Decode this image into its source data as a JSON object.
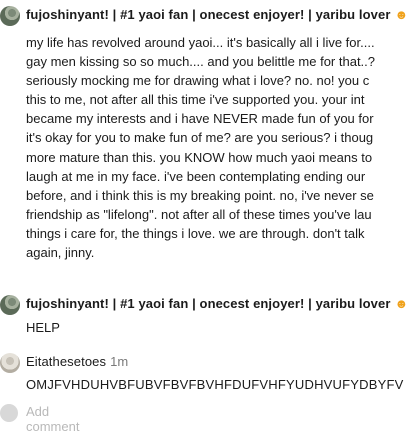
{
  "comments": [
    {
      "author": "fujoshinyant! | #1 yaoi fan | onecest enjoyer! | yaribu lover",
      "badge": "☻",
      "lines": [
        "my life has revolved around yaoi... it's basically all i live for....",
        "gay men kissing so so much.... and you belittle me for that..?",
        "seriously mocking me for drawing what i love? no. no! you c",
        "this to me, not after all this time i've supported you. your int",
        "became my interests and i have NEVER made fun of you for",
        "it's okay for you to make fun of me? are you serious? i thoug",
        "more mature than this. you KNOW how much yaoi means to",
        "laugh at me in my face. i've been contemplating ending our",
        "before, and i think this is my breaking point. no, i've never se",
        "friendship as \"lifelong\". not after all of these times you've lau",
        "things i care for, the things i love. we are through. don't talk",
        "again, jinny."
      ]
    },
    {
      "author": "fujoshinyant! | #1 yaoi fan | onecest enjoyer! | yaribu lover",
      "badge": "☻",
      "text": "HELP"
    },
    {
      "author": "Eitathesetoes",
      "time": "1m",
      "text": "OMJFVHDUHVBFUBVFBVFBVHFDUFVHFYUDHVUFYDBYFV"
    }
  ],
  "add_comment": {
    "placeholder": "Add comment"
  }
}
